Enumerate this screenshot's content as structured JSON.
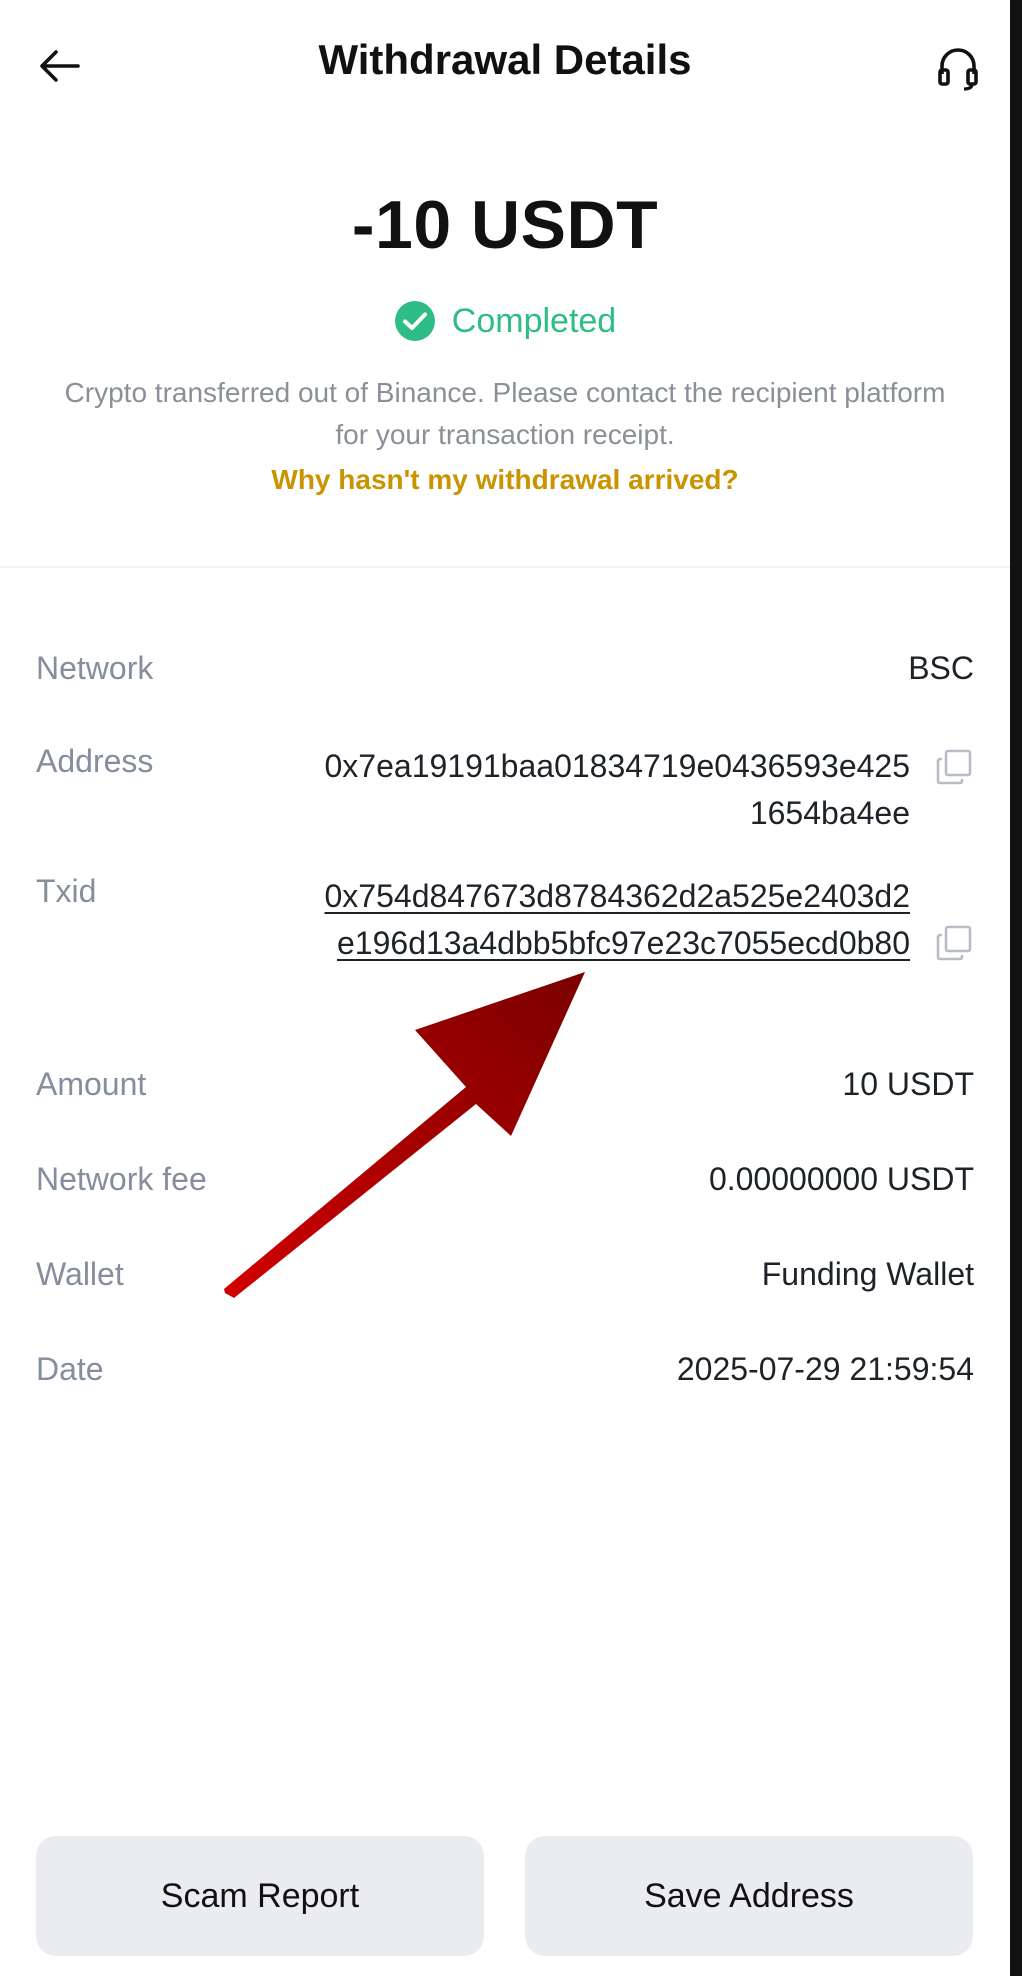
{
  "header": {
    "title": "Withdrawal Details",
    "back_icon": "arrow-left-icon",
    "support_icon": "headset-icon"
  },
  "summary": {
    "amount": "-10 USDT",
    "status": "Completed",
    "description": "Crypto transferred out of Binance. Please contact the recipient platform for your transaction receipt.",
    "help_link": "Why hasn't my withdrawal arrived?"
  },
  "details": {
    "network": {
      "label": "Network",
      "value": "BSC"
    },
    "address": {
      "label": "Address",
      "value": "0x7ea19191baa01834719e0436593e4251654ba4ee"
    },
    "txid": {
      "label": "Txid",
      "value": "0x754d847673d8784362d2a525e2403d2e196d13a4dbb5bfc97e23c7055ecd0b80"
    },
    "amount": {
      "label": "Amount",
      "value": "10 USDT"
    },
    "fee": {
      "label": "Network fee",
      "value": "0.00000000 USDT"
    },
    "wallet": {
      "label": "Wallet",
      "value": "Funding Wallet"
    },
    "date": {
      "label": "Date",
      "value": "2025-07-29 21:59:54"
    }
  },
  "buttons": {
    "scam_report": "Scam Report",
    "save_address": "Save Address"
  },
  "colors": {
    "status_green": "#2ebd85",
    "link_gold": "#c99400",
    "annotation_arrow": "#a00000",
    "button_bg": "#eaecef"
  }
}
